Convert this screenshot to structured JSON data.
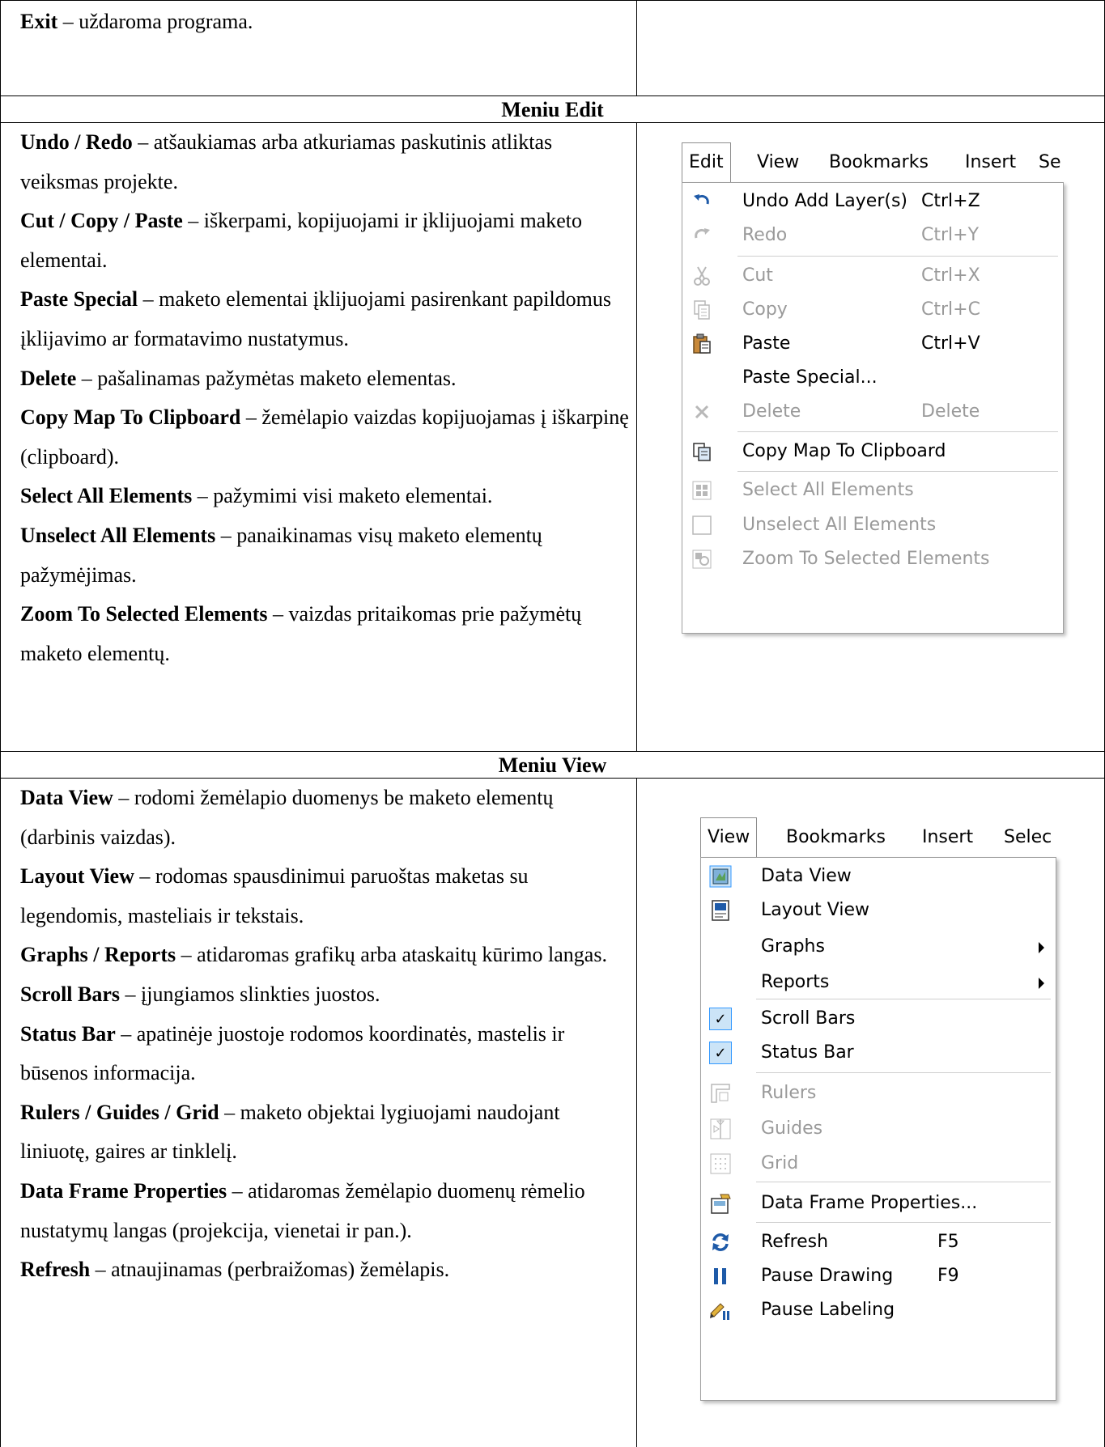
{
  "exit_row": {
    "term": "Exit",
    "desc": " – uždaroma programa."
  },
  "edit_section": {
    "heading": "Meniu Edit",
    "items": [
      {
        "term": "Undo / Redo",
        "desc": " – atšaukiamas arba atkuriamas paskutinis atliktas veiksmas projekte."
      },
      {
        "term": "Cut / Copy / Paste",
        "desc": " – iškerpami, kopijuojami ir įklijuojami maketo elementai."
      },
      {
        "term": "Paste Special",
        "desc": " – maketo elementai įklijuojami pasirenkant papildomus įklijavimo ar formatavimo nustatymus."
      },
      {
        "term": "Delete",
        "desc": " – pašalinamas pažymėtas maketo elementas."
      },
      {
        "term": "Copy Map To Clipboard",
        "desc": " – žemėlapio vaizdas kopijuojamas į iškarpinę (clipboard)."
      },
      {
        "term": "Select All Elements",
        "desc": " – pažymimi visi maketo elementai."
      },
      {
        "term": "Unselect All Elements",
        "desc": " – panaikinamas visų maketo elementų pažymėjimas."
      },
      {
        "term": "Zoom To Selected Elements",
        "desc": " – vaizdas pritaikomas prie pažymėtų maketo elementų."
      }
    ],
    "menu": {
      "bar": [
        "Edit",
        "View",
        "Bookmarks",
        "Insert",
        "Se"
      ],
      "entries": [
        {
          "icon": "undo-icon",
          "label": "Undo Add Layer(s)",
          "shortcut": "Ctrl+Z",
          "disabled": false
        },
        {
          "icon": "redo-icon",
          "label": "Redo",
          "shortcut": "Ctrl+Y",
          "disabled": true
        },
        {
          "icon": "cut-icon",
          "label": "Cut",
          "shortcut": "Ctrl+X",
          "disabled": true
        },
        {
          "icon": "copy-icon",
          "label": "Copy",
          "shortcut": "Ctrl+C",
          "disabled": true
        },
        {
          "icon": "paste-icon",
          "label": "Paste",
          "shortcut": "Ctrl+V",
          "disabled": false
        },
        {
          "icon": "",
          "label": "Paste Special...",
          "shortcut": "",
          "disabled": false
        },
        {
          "icon": "delete-icon",
          "label": "Delete",
          "shortcut": "Delete",
          "disabled": true
        },
        {
          "icon": "copy-map-icon",
          "label": "Copy Map To Clipboard",
          "shortcut": "",
          "disabled": false
        },
        {
          "icon": "select-all-icon",
          "label": "Select All Elements",
          "shortcut": "",
          "disabled": true
        },
        {
          "icon": "unselect-all-icon",
          "label": "Unselect All Elements",
          "shortcut": "",
          "disabled": true
        },
        {
          "icon": "zoom-selected-icon",
          "label": "Zoom To Selected Elements",
          "shortcut": "",
          "disabled": true
        }
      ]
    }
  },
  "view_section": {
    "heading": "Meniu View",
    "items": [
      {
        "term": "Data View",
        "desc": " – rodomi žemėlapio duomenys be maketo elementų (darbinis vaizdas)."
      },
      {
        "term": "Layout View",
        "desc": " – rodomas spausdinimui paruoštas maketas su legendomis, masteliais ir tekstais."
      },
      {
        "term": "Graphs / Reports",
        "desc": " – atidaromas grafikų arba ataskaitų kūrimo langas."
      },
      {
        "term": "Scroll Bars",
        "desc": " – įjungiamos slinkties juostos."
      },
      {
        "term": "Status Bar",
        "desc": " – apatinėje juostoje rodomos koordinatės, mastelis ir būsenos informacija."
      },
      {
        "term": "Rulers / Guides / Grid",
        "desc": " – maketo objektai lygiuojami naudojant liniuotę, gaires ar tinklelį."
      },
      {
        "term": "Data Frame Properties",
        "desc": " – atidaromas žemėlapio duomenų rėmelio nustatymų langas (projekcija, vienetai ir pan.)."
      },
      {
        "term": "Refresh",
        "desc": " – atnaujinamas (perbraižomas) žemėlapis."
      }
    ],
    "menu": {
      "bar": [
        "View",
        "Bookmarks",
        "Insert",
        "Selec"
      ],
      "entries": [
        {
          "icon": "data-view-icon",
          "label": "Data View",
          "shortcut": "",
          "disabled": false
        },
        {
          "icon": "layout-view-icon",
          "label": "Layout View",
          "shortcut": "",
          "disabled": false
        },
        {
          "icon": "",
          "label": "Graphs",
          "shortcut": "",
          "disabled": false,
          "submenu": true
        },
        {
          "icon": "",
          "label": "Reports",
          "shortcut": "",
          "disabled": false,
          "submenu": true
        },
        {
          "icon": "check-icon",
          "label": "Scroll Bars",
          "shortcut": "",
          "disabled": false,
          "checked": true
        },
        {
          "icon": "check-icon",
          "label": "Status Bar",
          "shortcut": "",
          "disabled": false,
          "checked": true
        },
        {
          "icon": "rulers-icon",
          "label": "Rulers",
          "shortcut": "",
          "disabled": true
        },
        {
          "icon": "guides-icon",
          "label": "Guides",
          "shortcut": "",
          "disabled": true
        },
        {
          "icon": "grid-icon",
          "label": "Grid",
          "shortcut": "",
          "disabled": true
        },
        {
          "icon": "data-frame-properties-icon",
          "label": "Data Frame Properties...",
          "shortcut": "",
          "disabled": false
        },
        {
          "icon": "refresh-icon",
          "label": "Refresh",
          "shortcut": "F5",
          "disabled": false
        },
        {
          "icon": "pause-drawing-icon",
          "label": "Pause Drawing",
          "shortcut": "F9",
          "disabled": false
        },
        {
          "icon": "pause-labeling-icon",
          "label": "Pause Labeling",
          "shortcut": "",
          "disabled": false
        }
      ]
    }
  },
  "colors": {
    "border": "#000000",
    "menu_disabled": "#9a9a9a",
    "check_bg": "#cce4f7",
    "check_border": "#3399ff",
    "icon_blue": "#1e5aa8"
  }
}
